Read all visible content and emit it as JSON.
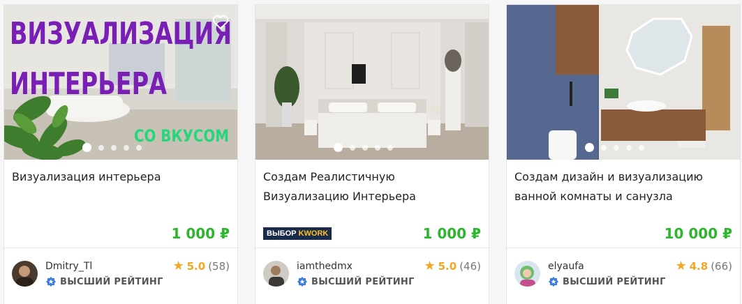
{
  "cards": [
    {
      "image_text": {
        "line1": "ВИЗУАЛИЗАЦИЯ",
        "line2": "ИНТЕРЬЕРА",
        "line3": "СО ВКУСОМ"
      },
      "title": "Визуализация интерьера",
      "price": "1 000 ₽",
      "seller": "Dmitry_Tl",
      "badge": "ВЫСШИЙ РЕЙТИНГ",
      "rating": "5.0",
      "reviews": "(58)",
      "favorite_icon": "heart-icon"
    },
    {
      "title": "Создам Реалистичную Визуализацию Интерьера",
      "price": "1 000 ₽",
      "kwork_badge": {
        "part1": "ВЫБОР",
        "part2": "KWORK"
      },
      "seller": "iamthedmx",
      "badge": "ВЫСШИЙ РЕЙТИНГ",
      "rating": "5.0",
      "reviews": "(46)"
    },
    {
      "title": "Создам дизайн и визуализацию ванной комнаты и санузла",
      "price": "10 000 ₽",
      "seller": "elyaufa",
      "badge": "ВЫСШИЙ РЕЙТИНГ",
      "rating": "4.8",
      "reviews": "(66)"
    }
  ],
  "colors": {
    "price": "#2cb62c",
    "star": "#f5a623",
    "badge_icon": "#3d7ce0",
    "purple_text": "#7a1fb5",
    "green_text": "#27d67a",
    "kwork_bg": "#1a2a4a"
  }
}
